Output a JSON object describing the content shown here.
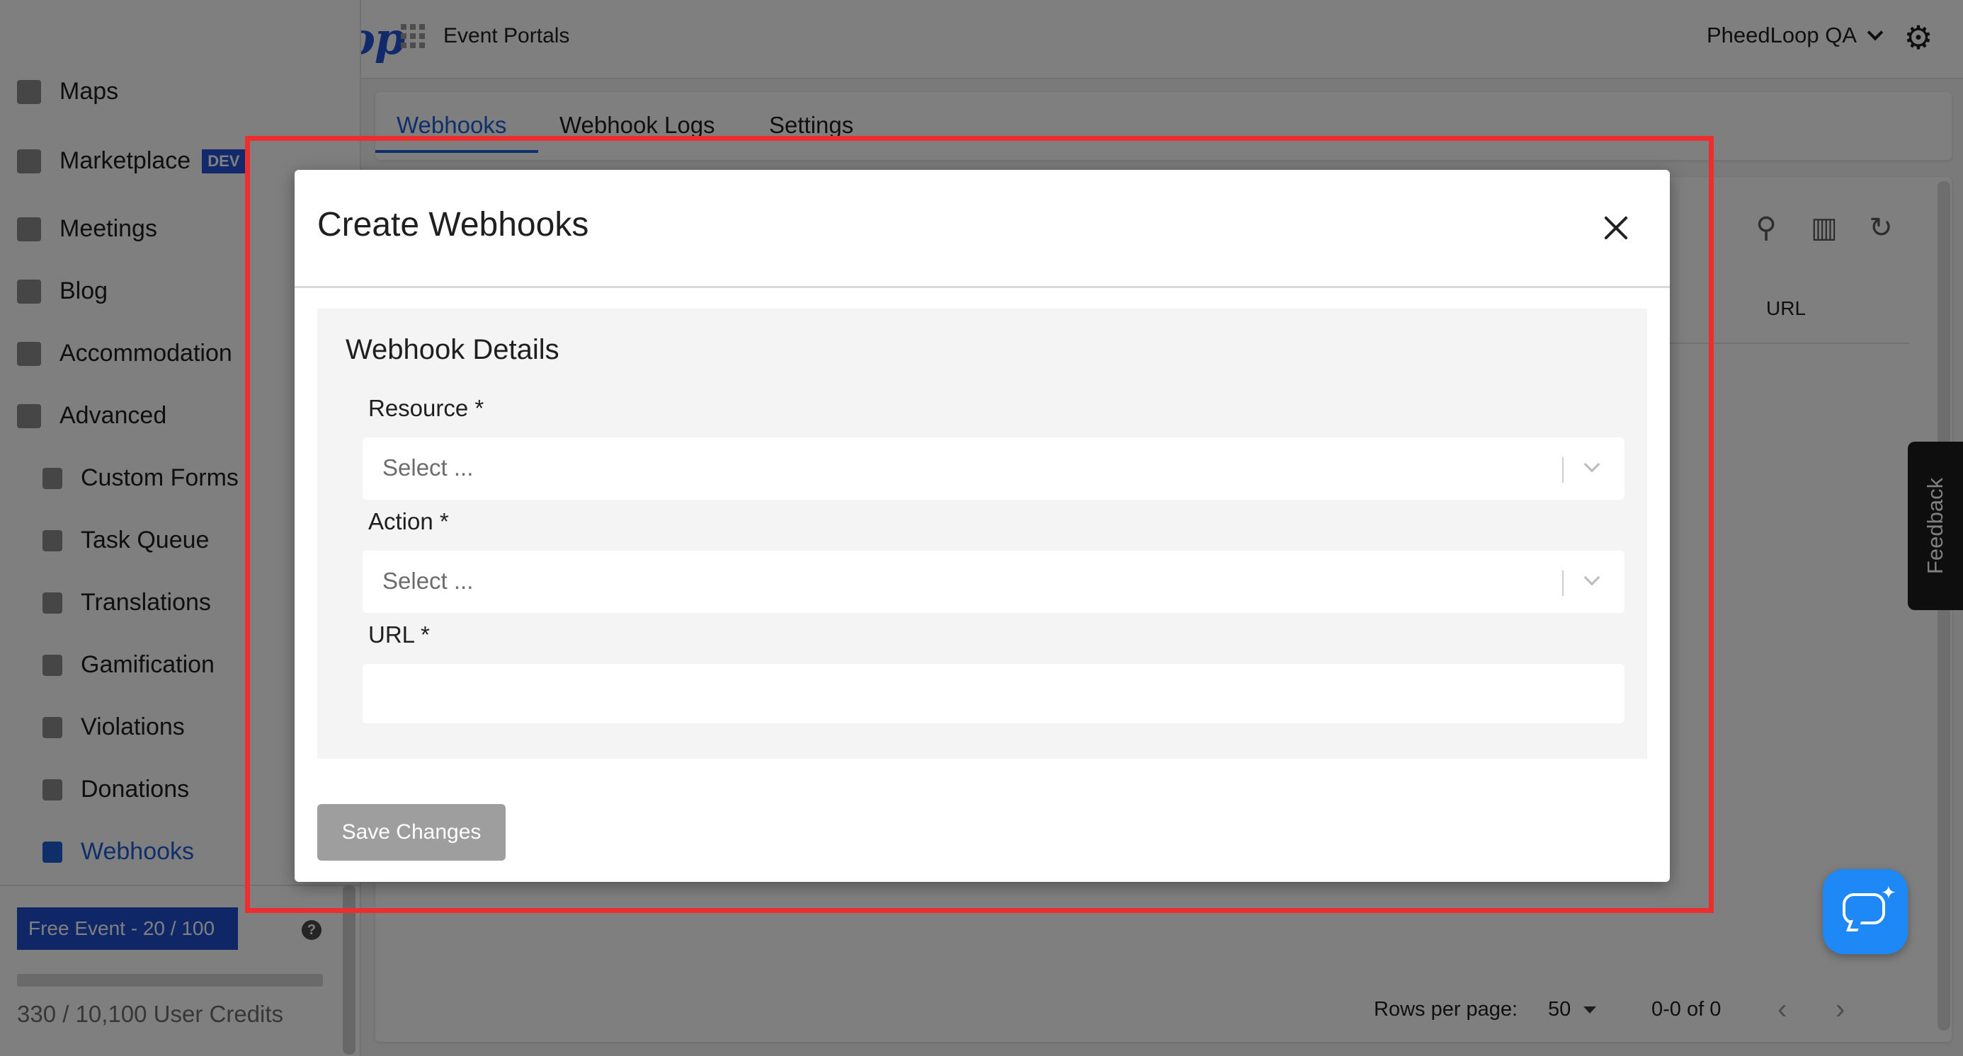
{
  "header": {
    "logo": "pheedloop",
    "portals_label": "Event Portals",
    "account_name": "PheedLoop QA"
  },
  "sidebar": {
    "items": [
      {
        "label": "Maps",
        "icon": "map-icon"
      },
      {
        "label": "Marketplace",
        "icon": "cart-icon",
        "badge": "DEV"
      },
      {
        "label": "Meetings",
        "icon": "calendar-icon"
      },
      {
        "label": "Blog",
        "icon": "document-icon"
      },
      {
        "label": "Accommodation",
        "icon": "bed-icon"
      },
      {
        "label": "Advanced",
        "icon": "gear-icon"
      },
      {
        "label": "Custom Forms",
        "icon": "form-icon"
      },
      {
        "label": "Task Queue",
        "icon": "layers-icon"
      },
      {
        "label": "Translations",
        "icon": "translate-icon"
      },
      {
        "label": "Gamification",
        "icon": "gamepad-icon"
      },
      {
        "label": "Violations",
        "icon": "flag-icon"
      },
      {
        "label": "Donations",
        "icon": "donation-icon"
      },
      {
        "label": "Webhooks",
        "icon": "webhook-icon",
        "active": true
      }
    ],
    "plan_label": "Free Event - 20 / 100",
    "credits_label": "330 / 10,100 User Credits",
    "help_glyph": "?"
  },
  "main": {
    "tabs": [
      {
        "label": "Webhooks",
        "active": true
      },
      {
        "label": "Webhook Logs"
      },
      {
        "label": "Settings"
      }
    ],
    "table": {
      "columns": [
        "URL"
      ]
    },
    "pagination": {
      "rows_per_page_label": "Rows per page:",
      "rows_per_page_value": "50",
      "range": "0-0 of 0"
    },
    "feedback_label": "Feedback"
  },
  "modal": {
    "title": "Create Webhooks",
    "section_title": "Webhook Details",
    "fields": {
      "resource": {
        "label": "Resource *",
        "placeholder": "Select ..."
      },
      "action": {
        "label": "Action *",
        "placeholder": "Select ..."
      },
      "url": {
        "label": "URL *",
        "value": ""
      }
    },
    "save_label": "Save Changes"
  },
  "colors": {
    "accent": "#1f5fd6",
    "highlight": "#ee2e2e",
    "chat": "#1e88f6"
  }
}
